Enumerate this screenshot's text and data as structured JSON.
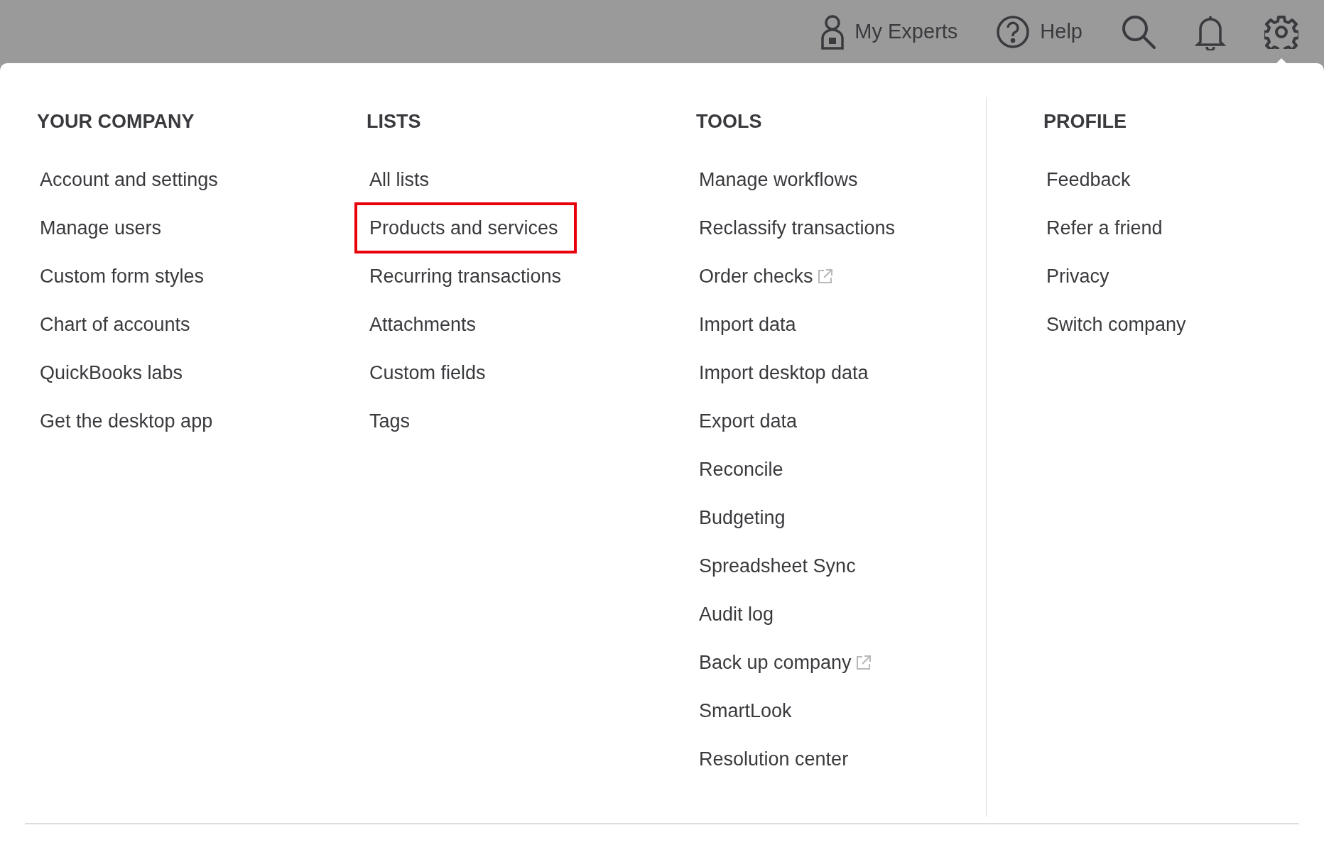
{
  "top_bar": [
    {
      "kind": "experts",
      "label": "My Experts"
    },
    {
      "kind": "help",
      "label": "Help"
    },
    {
      "kind": "search"
    },
    {
      "kind": "notifications"
    },
    {
      "kind": "settings",
      "selected": true
    }
  ],
  "columns": [
    {
      "heading": "YOUR COMPANY",
      "items": [
        {
          "label": "Account and settings",
          "highlighted": false,
          "external": false
        },
        {
          "label": "Manage users",
          "highlighted": false,
          "external": false
        },
        {
          "label": "Custom form styles",
          "highlighted": false,
          "external": false
        },
        {
          "label": "Chart of accounts",
          "highlighted": false,
          "external": false
        },
        {
          "label": "QuickBooks labs",
          "highlighted": false,
          "external": false
        },
        {
          "label": "Get the desktop app",
          "highlighted": false,
          "external": false
        }
      ]
    },
    {
      "heading": "LISTS",
      "items": [
        {
          "label": "All lists",
          "highlighted": false,
          "external": false
        },
        {
          "label": "Products and services",
          "highlighted": true,
          "external": false
        },
        {
          "label": "Recurring transactions",
          "highlighted": false,
          "external": false
        },
        {
          "label": "Attachments",
          "highlighted": false,
          "external": false
        },
        {
          "label": "Custom fields",
          "highlighted": false,
          "external": false
        },
        {
          "label": "Tags",
          "highlighted": false,
          "external": false
        }
      ]
    },
    {
      "heading": "TOOLS",
      "items": [
        {
          "label": "Manage workflows",
          "highlighted": false,
          "external": false
        },
        {
          "label": "Reclassify transactions",
          "highlighted": false,
          "external": false
        },
        {
          "label": "Order checks",
          "highlighted": false,
          "external": true
        },
        {
          "label": "Import data",
          "highlighted": false,
          "external": false
        },
        {
          "label": "Import desktop data",
          "highlighted": false,
          "external": false
        },
        {
          "label": "Export data",
          "highlighted": false,
          "external": false
        },
        {
          "label": "Reconcile",
          "highlighted": false,
          "external": false
        },
        {
          "label": "Budgeting",
          "highlighted": false,
          "external": false
        },
        {
          "label": "Spreadsheet Sync",
          "highlighted": false,
          "external": false
        },
        {
          "label": "Audit log",
          "highlighted": false,
          "external": false
        },
        {
          "label": "Back up company",
          "highlighted": false,
          "external": true
        },
        {
          "label": "SmartLook",
          "highlighted": false,
          "external": false
        },
        {
          "label": "Resolution center",
          "highlighted": false,
          "external": false
        }
      ]
    },
    {
      "heading": "PROFILE",
      "items": [
        {
          "label": "Feedback",
          "highlighted": false,
          "external": false
        },
        {
          "label": "Refer a friend",
          "highlighted": false,
          "external": false
        },
        {
          "label": "Privacy",
          "highlighted": false,
          "external": false
        },
        {
          "label": "Switch company",
          "highlighted": false,
          "external": false
        }
      ]
    }
  ]
}
